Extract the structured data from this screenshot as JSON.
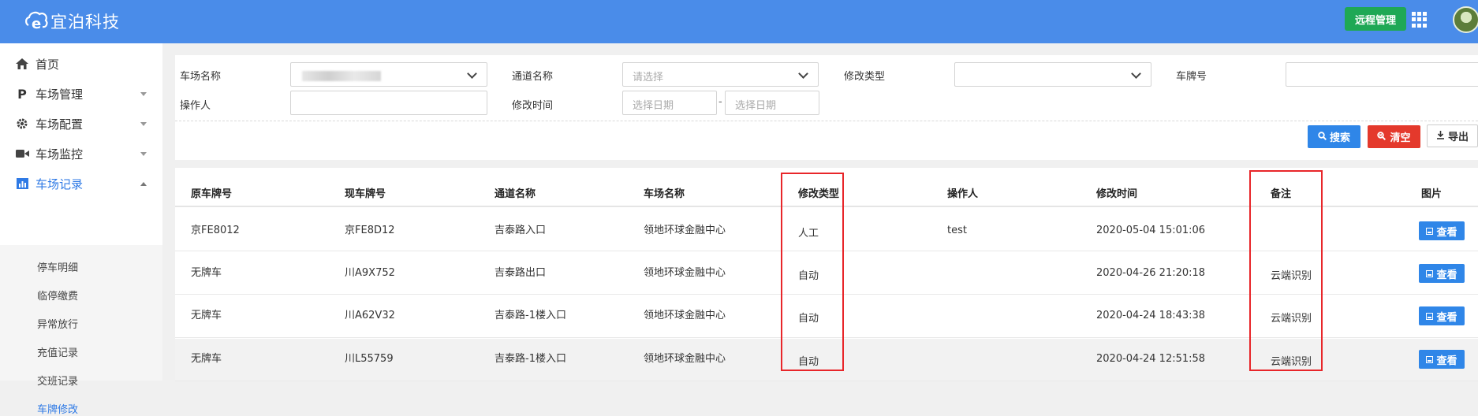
{
  "header": {
    "brand": "宜泊科技",
    "remote_btn": "远程管理",
    "apps_icon": "grid-icon",
    "avatar_icon": "avatar"
  },
  "sidebar": {
    "items": [
      {
        "label": "首页",
        "icon": "home-icon"
      },
      {
        "label": "车场管理",
        "icon": "parking-icon"
      },
      {
        "label": "车场配置",
        "icon": "gear-icon"
      },
      {
        "label": "车场监控",
        "icon": "camera-icon"
      },
      {
        "label": "车场记录",
        "icon": "bar-chart-icon"
      }
    ],
    "sub_items": [
      "停车明细",
      "临停缴费",
      "异常放行",
      "充值记录",
      "交班记录",
      "车牌修改"
    ],
    "active_sub": "车牌修改"
  },
  "filter": {
    "parking_label": "车场名称",
    "channel_label": "通道名称",
    "channel_placeholder": "请选择",
    "modify_type_label": "修改类型",
    "plate_label": "车牌号",
    "operator_label": "操作人",
    "modify_time_label": "修改时间",
    "date_start_placeholder": "选择日期",
    "date_sep": "-",
    "date_end_placeholder": "选择日期",
    "search_btn": "搜索",
    "clear_btn": "清空",
    "export_btn": "导出"
  },
  "table": {
    "columns": [
      "原车牌号",
      "现车牌号",
      "通道名称",
      "车场名称",
      "修改类型",
      "操作人",
      "修改时间",
      "备注",
      "图片"
    ],
    "view_btn": "查看",
    "rows": [
      {
        "orig": "京FE8012",
        "cur": "京FE8D12",
        "channel": "吉泰路入口",
        "lot": "领地环球金融中心",
        "type": "人工",
        "operator": "test",
        "time": "2020-05-04 15:01:06",
        "note": ""
      },
      {
        "orig": "无牌车",
        "cur": "川A9X752",
        "channel": "吉泰路出口",
        "lot": "领地环球金融中心",
        "type": "自动",
        "operator": "",
        "time": "2020-04-26 21:20:18",
        "note": "云端识别"
      },
      {
        "orig": "无牌车",
        "cur": "川A62V32",
        "channel": "吉泰路-1楼入口",
        "lot": "领地环球金融中心",
        "type": "自动",
        "operator": "",
        "time": "2020-04-24 18:43:38",
        "note": "云端识别"
      },
      {
        "orig": "无牌车",
        "cur": "川L55759",
        "channel": "吉泰路-1楼入口",
        "lot": "领地环球金融中心",
        "type": "自动",
        "operator": "",
        "time": "2020-04-24 12:51:58",
        "note": "云端识别"
      }
    ]
  },
  "colors": {
    "header_bg": "#4a8ce9",
    "accent": "#2f7ae5",
    "remote_btn_bg": "#1fa855",
    "clear_btn_bg": "#e4392c",
    "highlight": "#e8262a"
  }
}
